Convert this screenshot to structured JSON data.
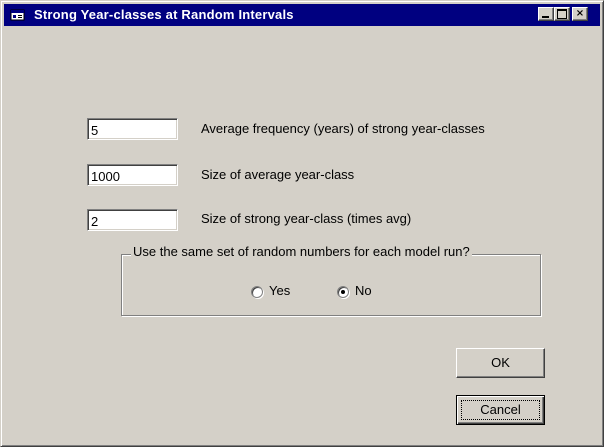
{
  "window": {
    "title": "Strong Year-classes at Random Intervals",
    "controls": {
      "minimize_icon": "minimize-icon",
      "maximize_icon": "maximize-icon",
      "close_glyph": "×"
    },
    "colors": {
      "titlebar": "#000080",
      "face": "#d4d0c8"
    }
  },
  "fields": [
    {
      "value": "5",
      "label": "Average frequency (years) of strong year-classes"
    },
    {
      "value": "1000",
      "label": "Size of average year-class"
    },
    {
      "value": "2",
      "label": "Size of strong year-class (times avg)"
    }
  ],
  "random_group": {
    "legend": "Use the same set of random numbers for each model run?",
    "options": [
      {
        "label": "Yes",
        "selected": false
      },
      {
        "label": "No",
        "selected": true
      }
    ]
  },
  "buttons": {
    "ok": "OK",
    "cancel": "Cancel"
  }
}
